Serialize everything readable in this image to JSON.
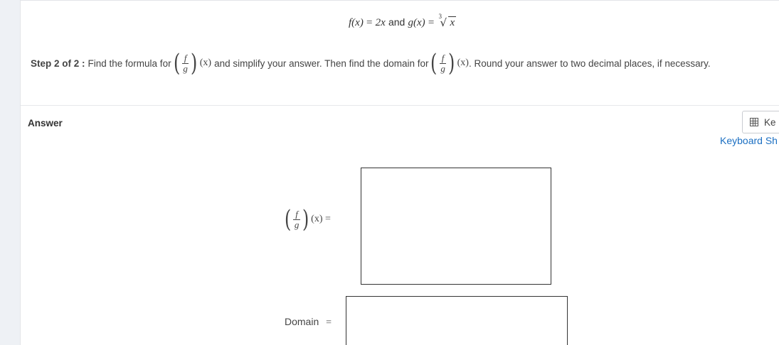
{
  "problem": {
    "given": {
      "f_lhs": "f(x)",
      "f_rhs": "2x",
      "connector": "and",
      "g_lhs": "g(x)",
      "equals": "=",
      "root_index": "3",
      "radicand": "x"
    },
    "step": {
      "label": "Step 2 of 2 :",
      "text_1": "Find the formula for",
      "text_2": "and simplify your answer. Then find the domain for",
      "text_3": ". Round your answer to two decimal places, if necessary.",
      "frac_num": "f",
      "frac_den": "g",
      "arg": "(x)"
    }
  },
  "answer": {
    "label": "Answer",
    "keypad_button": "Ke",
    "keyboard_shortcuts_link": "Keyboard Sh",
    "formula_eq": "(x) =",
    "domain_label": "Domain",
    "domain_eq": "=",
    "formula_value": "",
    "domain_value": ""
  },
  "icons": {
    "keypad": "calculator-icon"
  }
}
